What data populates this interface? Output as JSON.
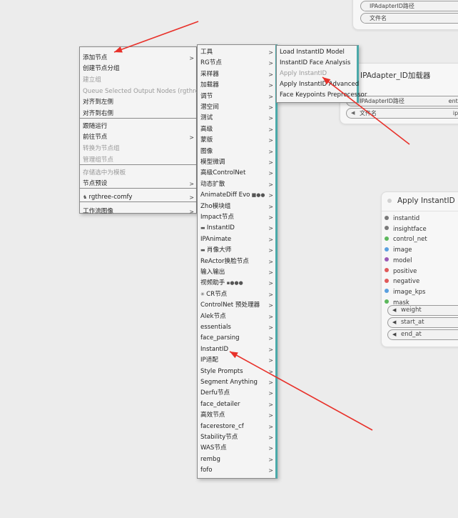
{
  "ipadapter_top_node": {
    "widgets": [
      {
        "label": "IPAdapterID路径"
      },
      {
        "label": "文件名"
      }
    ]
  },
  "ipadapter_node": {
    "title": "IPAdapter_ID加载器",
    "widgets": [
      {
        "label": "IPAdapterID路径",
        "value": "enter"
      },
      {
        "label": "文件名",
        "value": "ip-a"
      }
    ]
  },
  "apply_instantid_node": {
    "title": "Apply InstantID",
    "inputs": [
      {
        "label": "instantid",
        "color": "#7a7a7a"
      },
      {
        "label": "insightface",
        "color": "#7a7a7a"
      },
      {
        "label": "control_net",
        "color": "#5cb85c"
      },
      {
        "label": "image",
        "color": "#5aa0e0"
      },
      {
        "label": "model",
        "color": "#9b59b6"
      },
      {
        "label": "positive",
        "color": "#e05a5a"
      },
      {
        "label": "negative",
        "color": "#e05a5a"
      },
      {
        "label": "image_kps",
        "color": "#5aa0e0"
      },
      {
        "label": "mask",
        "color": "#5cb85c"
      }
    ],
    "widgets": [
      {
        "label": "weight"
      },
      {
        "label": "start_at"
      },
      {
        "label": "end_at"
      }
    ]
  },
  "context_menu": {
    "items": [
      {
        "label": "添加节点",
        "submenu": true,
        "disabled": false
      },
      {
        "label": "创建节点分组",
        "submenu": false,
        "disabled": false
      },
      {
        "label": "建立组",
        "submenu": false,
        "disabled": true
      },
      {
        "label": "Queue Selected Output Nodes (rgthree)",
        "submenu": false,
        "disabled": true
      },
      {
        "label": "对齐到左侧",
        "submenu": false,
        "disabled": false
      },
      {
        "label": "对齐到右侧",
        "submenu": false,
        "disabled": false
      },
      {
        "label": "跟随运行",
        "submenu": false,
        "disabled": false
      },
      {
        "label": "前往节点",
        "submenu": true,
        "disabled": false
      },
      {
        "label": "转换为节点组",
        "submenu": false,
        "disabled": true
      },
      {
        "label": "管理组节点",
        "submenu": false,
        "disabled": true
      },
      {
        "label": "存储选中为模板",
        "submenu": false,
        "disabled": true
      },
      {
        "label": "节点预设",
        "submenu": true,
        "disabled": false
      },
      {
        "label": "rgthree-comfy",
        "submenu": true,
        "disabled": false,
        "icon": "rgthree-icon"
      },
      {
        "label": "工作流图像",
        "submenu": true,
        "disabled": false
      }
    ]
  },
  "add_node_menu": {
    "items": [
      {
        "label": "工具"
      },
      {
        "label": "RG节点"
      },
      {
        "label": "采样器"
      },
      {
        "label": "加载器"
      },
      {
        "label": "调节"
      },
      {
        "label": "潜空间"
      },
      {
        "label": "测试"
      },
      {
        "label": "高级"
      },
      {
        "label": "蒙版"
      },
      {
        "label": "图像"
      },
      {
        "label": "模型微调"
      },
      {
        "label": "高级ControlNet"
      },
      {
        "label": "动态扩散"
      },
      {
        "label": "AnimateDiff Evo"
      },
      {
        "label": "Zho模块组"
      },
      {
        "label": "Impact节点"
      },
      {
        "label": "InstantID"
      },
      {
        "label": "IPAnimate"
      },
      {
        "label": "肖像大师"
      },
      {
        "label": "ReActor换脸节点"
      },
      {
        "label": "输入输出"
      },
      {
        "label": "视频助手"
      },
      {
        "label": "CR节点"
      },
      {
        "label": "ControlNet 预处理器"
      },
      {
        "label": "Alek节点"
      },
      {
        "label": "essentials"
      },
      {
        "label": "face_parsing"
      },
      {
        "label": "InstantID"
      },
      {
        "label": "IP适配"
      },
      {
        "label": "Style Prompts"
      },
      {
        "label": "Segment Anything"
      },
      {
        "label": "Derfu节点"
      },
      {
        "label": "face_detailer"
      },
      {
        "label": "高效节点"
      },
      {
        "label": "facerestore_cf"
      },
      {
        "label": "Stability节点"
      },
      {
        "label": "WAS节点"
      },
      {
        "label": "rembg"
      },
      {
        "label": "fofo"
      }
    ]
  },
  "instantid_submenu": {
    "items": [
      {
        "label": "Load InstantID Model"
      },
      {
        "label": "InstantID Face Analysis"
      },
      {
        "label": "Apply InstantID"
      },
      {
        "label": "Apply InstantID Advanced"
      },
      {
        "label": "Face Keypoints Preprocessor"
      }
    ]
  },
  "glyphs": {
    "arrow": ">",
    "tri": "◀"
  },
  "colors": {
    "annotation_arrow": "#e8312a",
    "menu_accent": "#4aa9a9"
  }
}
